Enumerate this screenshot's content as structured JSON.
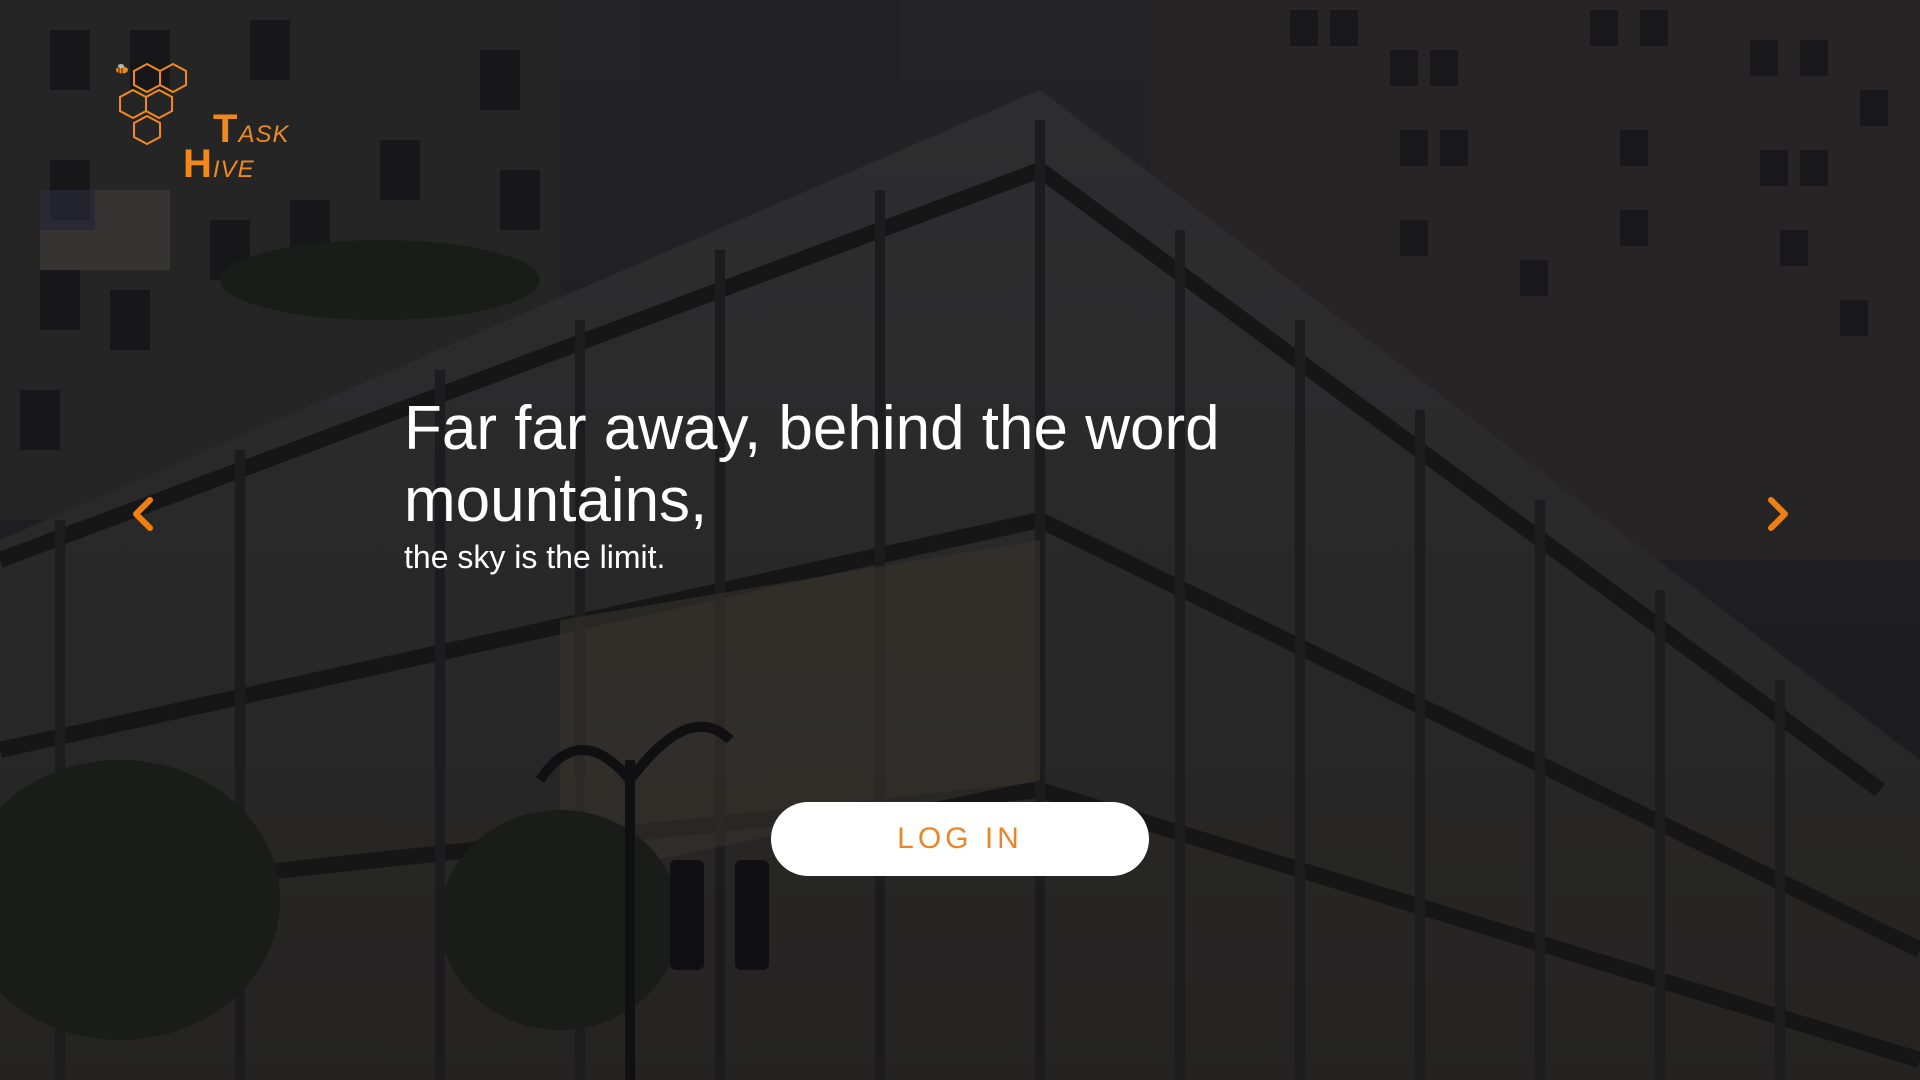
{
  "brand": {
    "logo_icon": "honeycomb-bee-icon",
    "word1_initial": "T",
    "word1_rest": "ASK",
    "word2_initial": "H",
    "word2_rest": "IVE",
    "accent_color": "#f08a1c"
  },
  "hero": {
    "background": "city-building-photo",
    "headline": "Far far away, behind the word mountains,",
    "subline": "the sky is the limit."
  },
  "carousel": {
    "prev_icon": "chevron-left-icon",
    "next_icon": "chevron-right-icon",
    "arrow_color": "#f07f12"
  },
  "actions": {
    "login_label": "LOG IN"
  }
}
